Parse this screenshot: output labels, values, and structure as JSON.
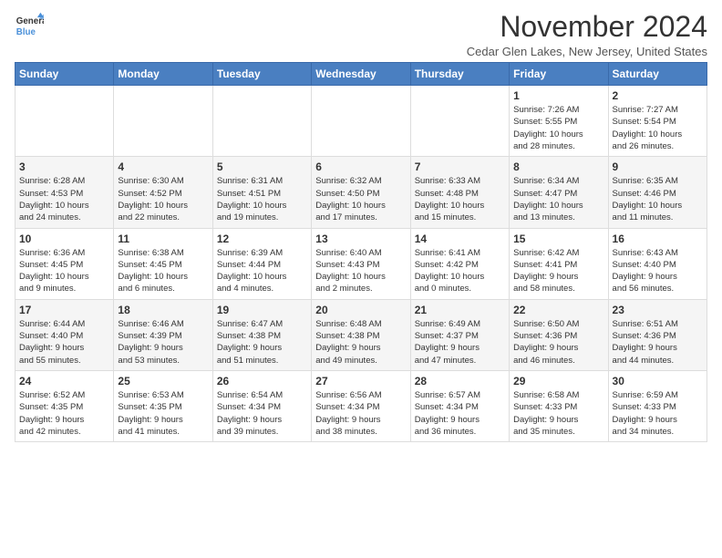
{
  "logo": {
    "general": "General",
    "blue": "Blue"
  },
  "title": "November 2024",
  "location": "Cedar Glen Lakes, New Jersey, United States",
  "days_of_week": [
    "Sunday",
    "Monday",
    "Tuesday",
    "Wednesday",
    "Thursday",
    "Friday",
    "Saturday"
  ],
  "weeks": [
    [
      {
        "day": "",
        "info": ""
      },
      {
        "day": "",
        "info": ""
      },
      {
        "day": "",
        "info": ""
      },
      {
        "day": "",
        "info": ""
      },
      {
        "day": "",
        "info": ""
      },
      {
        "day": "1",
        "info": "Sunrise: 7:26 AM\nSunset: 5:55 PM\nDaylight: 10 hours\nand 28 minutes."
      },
      {
        "day": "2",
        "info": "Sunrise: 7:27 AM\nSunset: 5:54 PM\nDaylight: 10 hours\nand 26 minutes."
      }
    ],
    [
      {
        "day": "3",
        "info": "Sunrise: 6:28 AM\nSunset: 4:53 PM\nDaylight: 10 hours\nand 24 minutes."
      },
      {
        "day": "4",
        "info": "Sunrise: 6:30 AM\nSunset: 4:52 PM\nDaylight: 10 hours\nand 22 minutes."
      },
      {
        "day": "5",
        "info": "Sunrise: 6:31 AM\nSunset: 4:51 PM\nDaylight: 10 hours\nand 19 minutes."
      },
      {
        "day": "6",
        "info": "Sunrise: 6:32 AM\nSunset: 4:50 PM\nDaylight: 10 hours\nand 17 minutes."
      },
      {
        "day": "7",
        "info": "Sunrise: 6:33 AM\nSunset: 4:48 PM\nDaylight: 10 hours\nand 15 minutes."
      },
      {
        "day": "8",
        "info": "Sunrise: 6:34 AM\nSunset: 4:47 PM\nDaylight: 10 hours\nand 13 minutes."
      },
      {
        "day": "9",
        "info": "Sunrise: 6:35 AM\nSunset: 4:46 PM\nDaylight: 10 hours\nand 11 minutes."
      }
    ],
    [
      {
        "day": "10",
        "info": "Sunrise: 6:36 AM\nSunset: 4:45 PM\nDaylight: 10 hours\nand 9 minutes."
      },
      {
        "day": "11",
        "info": "Sunrise: 6:38 AM\nSunset: 4:45 PM\nDaylight: 10 hours\nand 6 minutes."
      },
      {
        "day": "12",
        "info": "Sunrise: 6:39 AM\nSunset: 4:44 PM\nDaylight: 10 hours\nand 4 minutes."
      },
      {
        "day": "13",
        "info": "Sunrise: 6:40 AM\nSunset: 4:43 PM\nDaylight: 10 hours\nand 2 minutes."
      },
      {
        "day": "14",
        "info": "Sunrise: 6:41 AM\nSunset: 4:42 PM\nDaylight: 10 hours\nand 0 minutes."
      },
      {
        "day": "15",
        "info": "Sunrise: 6:42 AM\nSunset: 4:41 PM\nDaylight: 9 hours\nand 58 minutes."
      },
      {
        "day": "16",
        "info": "Sunrise: 6:43 AM\nSunset: 4:40 PM\nDaylight: 9 hours\nand 56 minutes."
      }
    ],
    [
      {
        "day": "17",
        "info": "Sunrise: 6:44 AM\nSunset: 4:40 PM\nDaylight: 9 hours\nand 55 minutes."
      },
      {
        "day": "18",
        "info": "Sunrise: 6:46 AM\nSunset: 4:39 PM\nDaylight: 9 hours\nand 53 minutes."
      },
      {
        "day": "19",
        "info": "Sunrise: 6:47 AM\nSunset: 4:38 PM\nDaylight: 9 hours\nand 51 minutes."
      },
      {
        "day": "20",
        "info": "Sunrise: 6:48 AM\nSunset: 4:38 PM\nDaylight: 9 hours\nand 49 minutes."
      },
      {
        "day": "21",
        "info": "Sunrise: 6:49 AM\nSunset: 4:37 PM\nDaylight: 9 hours\nand 47 minutes."
      },
      {
        "day": "22",
        "info": "Sunrise: 6:50 AM\nSunset: 4:36 PM\nDaylight: 9 hours\nand 46 minutes."
      },
      {
        "day": "23",
        "info": "Sunrise: 6:51 AM\nSunset: 4:36 PM\nDaylight: 9 hours\nand 44 minutes."
      }
    ],
    [
      {
        "day": "24",
        "info": "Sunrise: 6:52 AM\nSunset: 4:35 PM\nDaylight: 9 hours\nand 42 minutes."
      },
      {
        "day": "25",
        "info": "Sunrise: 6:53 AM\nSunset: 4:35 PM\nDaylight: 9 hours\nand 41 minutes."
      },
      {
        "day": "26",
        "info": "Sunrise: 6:54 AM\nSunset: 4:34 PM\nDaylight: 9 hours\nand 39 minutes."
      },
      {
        "day": "27",
        "info": "Sunrise: 6:56 AM\nSunset: 4:34 PM\nDaylight: 9 hours\nand 38 minutes."
      },
      {
        "day": "28",
        "info": "Sunrise: 6:57 AM\nSunset: 4:34 PM\nDaylight: 9 hours\nand 36 minutes."
      },
      {
        "day": "29",
        "info": "Sunrise: 6:58 AM\nSunset: 4:33 PM\nDaylight: 9 hours\nand 35 minutes."
      },
      {
        "day": "30",
        "info": "Sunrise: 6:59 AM\nSunset: 4:33 PM\nDaylight: 9 hours\nand 34 minutes."
      }
    ]
  ]
}
